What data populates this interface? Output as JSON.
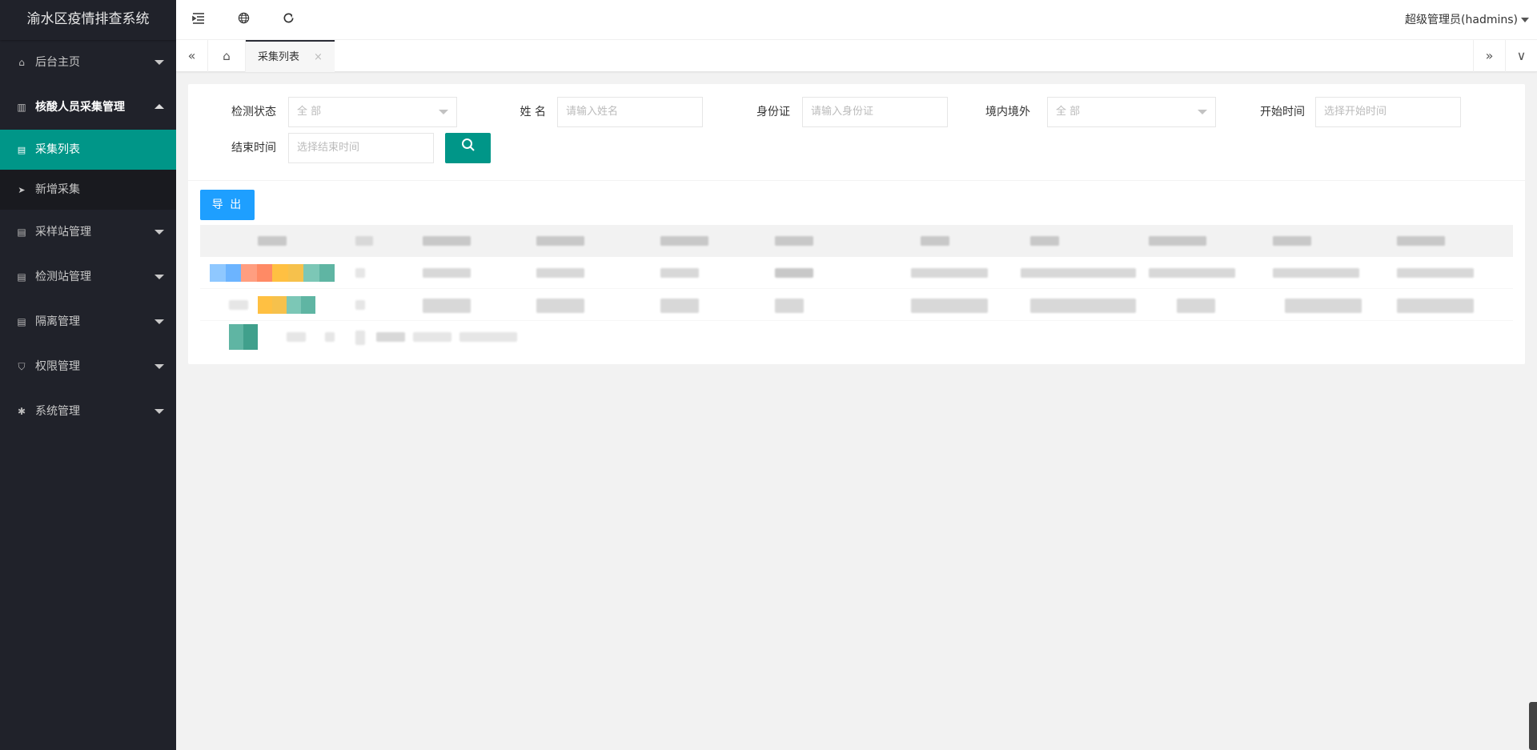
{
  "app": {
    "title": "渝水区疫情排查系统"
  },
  "sidebar": {
    "items": [
      {
        "label": "后台主页",
        "icon": "home-icon"
      },
      {
        "label": "核酸人员采集管理",
        "icon": "book-icon",
        "open": true,
        "children": [
          {
            "label": "采集列表",
            "icon": "document-icon",
            "active": true
          },
          {
            "label": "新增采集",
            "icon": "send-icon"
          }
        ]
      },
      {
        "label": "采样站管理",
        "icon": "document-icon"
      },
      {
        "label": "检测站管理",
        "icon": "document-icon"
      },
      {
        "label": "隔离管理",
        "icon": "document-icon"
      },
      {
        "label": "权限管理",
        "icon": "shield-icon"
      },
      {
        "label": "系统管理",
        "icon": "gear-icon"
      }
    ]
  },
  "header": {
    "user": "超级管理员(hadmins)"
  },
  "tabs": {
    "items": [
      {
        "label": "采集列表",
        "close": "×"
      }
    ]
  },
  "filters": {
    "status": {
      "label": "检测状态",
      "value": "全 部"
    },
    "name": {
      "label": "姓 名",
      "placeholder": "请输入姓名"
    },
    "idcard": {
      "label": "身份证",
      "placeholder": "请输入身份证"
    },
    "region": {
      "label": "境内境外",
      "value": "全 部"
    },
    "start": {
      "label": "开始时间",
      "placeholder": "选择开始时间"
    },
    "end": {
      "label": "结束时间",
      "placeholder": "选择结束时间"
    }
  },
  "actions": {
    "export_label": "导 出"
  },
  "colors": {
    "accent": "#009688",
    "export": "#1e9fff",
    "sidebar": "#20222a"
  }
}
